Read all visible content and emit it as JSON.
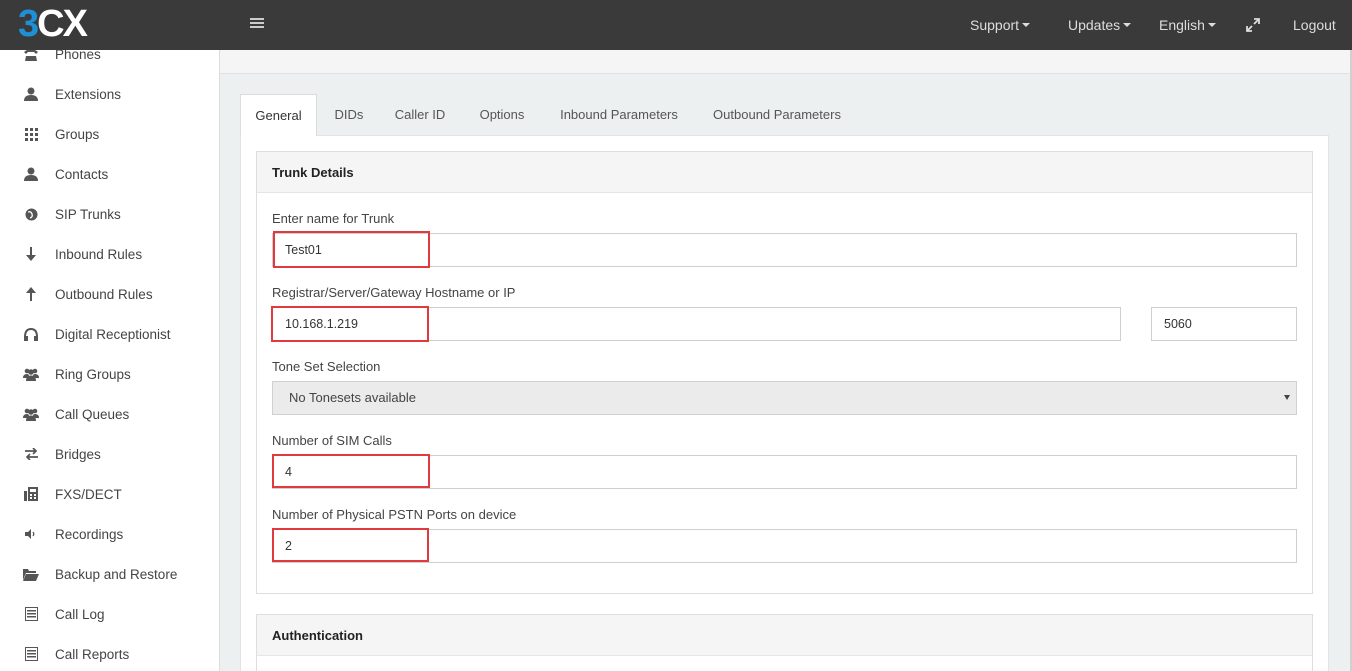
{
  "header": {
    "logo_three": "3",
    "logo_cx": "CX",
    "nav": {
      "support": "Support",
      "updates": "Updates",
      "language": "English",
      "logout": "Logout"
    }
  },
  "sidebar": {
    "items": [
      {
        "label": "Phones",
        "icon": "phone-icon"
      },
      {
        "label": "Extensions",
        "icon": "user-icon"
      },
      {
        "label": "Groups",
        "icon": "grid-icon"
      },
      {
        "label": "Contacts",
        "icon": "user-icon"
      },
      {
        "label": "SIP Trunks",
        "icon": "globe-icon"
      },
      {
        "label": "Inbound Rules",
        "icon": "arrow-down-icon"
      },
      {
        "label": "Outbound Rules",
        "icon": "arrow-up-icon"
      },
      {
        "label": "Digital Receptionist",
        "icon": "headphones-icon"
      },
      {
        "label": "Ring Groups",
        "icon": "users-icon"
      },
      {
        "label": "Call Queues",
        "icon": "users-icon"
      },
      {
        "label": "Bridges",
        "icon": "exchange-icon"
      },
      {
        "label": "FXS/DECT",
        "icon": "fax-icon"
      },
      {
        "label": "Recordings",
        "icon": "volume-icon"
      },
      {
        "label": "Backup and Restore",
        "icon": "folder-open-icon"
      },
      {
        "label": "Call Log",
        "icon": "list-icon"
      },
      {
        "label": "Call Reports",
        "icon": "list-icon"
      }
    ]
  },
  "tabs": [
    "General",
    "DIDs",
    "Caller ID",
    "Options",
    "Inbound Parameters",
    "Outbound Parameters"
  ],
  "trunk_details": {
    "title": "Trunk Details",
    "name_label": "Enter name for Trunk",
    "name_value": "Test01",
    "host_label": "Registrar/Server/Gateway Hostname or IP",
    "host_value": "10.168.1.219",
    "port_value": "5060",
    "tone_label": "Tone Set Selection",
    "tone_value": "No Tonesets available",
    "sim_label": "Number of SIM Calls",
    "sim_value": "4",
    "pstn_label": "Number of Physical PSTN Ports on device",
    "pstn_value": "2"
  },
  "authentication": {
    "title": "Authentication"
  },
  "colors": {
    "topbar": "#3a3a3a",
    "logo_blue": "#1e90d6",
    "highlight": "#e0393e"
  }
}
